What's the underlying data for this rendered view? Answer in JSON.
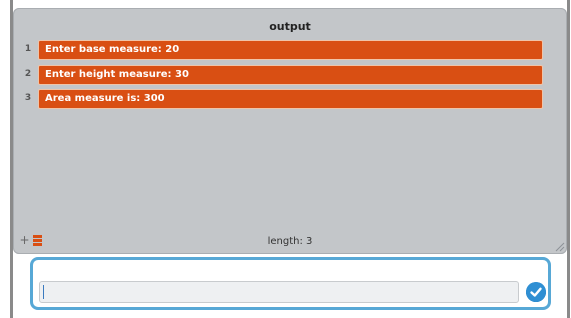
{
  "list": {
    "title": "output",
    "items": [
      {
        "index": "1",
        "value": "Enter base measure: 20"
      },
      {
        "index": "2",
        "value": "Enter height measure: 30"
      },
      {
        "index": "3",
        "value": "Area measure is: 300"
      }
    ],
    "length_label": "length: 3"
  },
  "input": {
    "value": "",
    "placeholder": ""
  },
  "icons": {
    "add": "plus-icon",
    "list": "list-glyph-icon",
    "submit": "checkmark-icon",
    "resize": "resize-grip-icon"
  },
  "colors": {
    "item_background": "#d94f13",
    "panel_background": "#c3c6c9",
    "input_border": "#57a8d6",
    "submit_button": "#2f8fd3"
  }
}
